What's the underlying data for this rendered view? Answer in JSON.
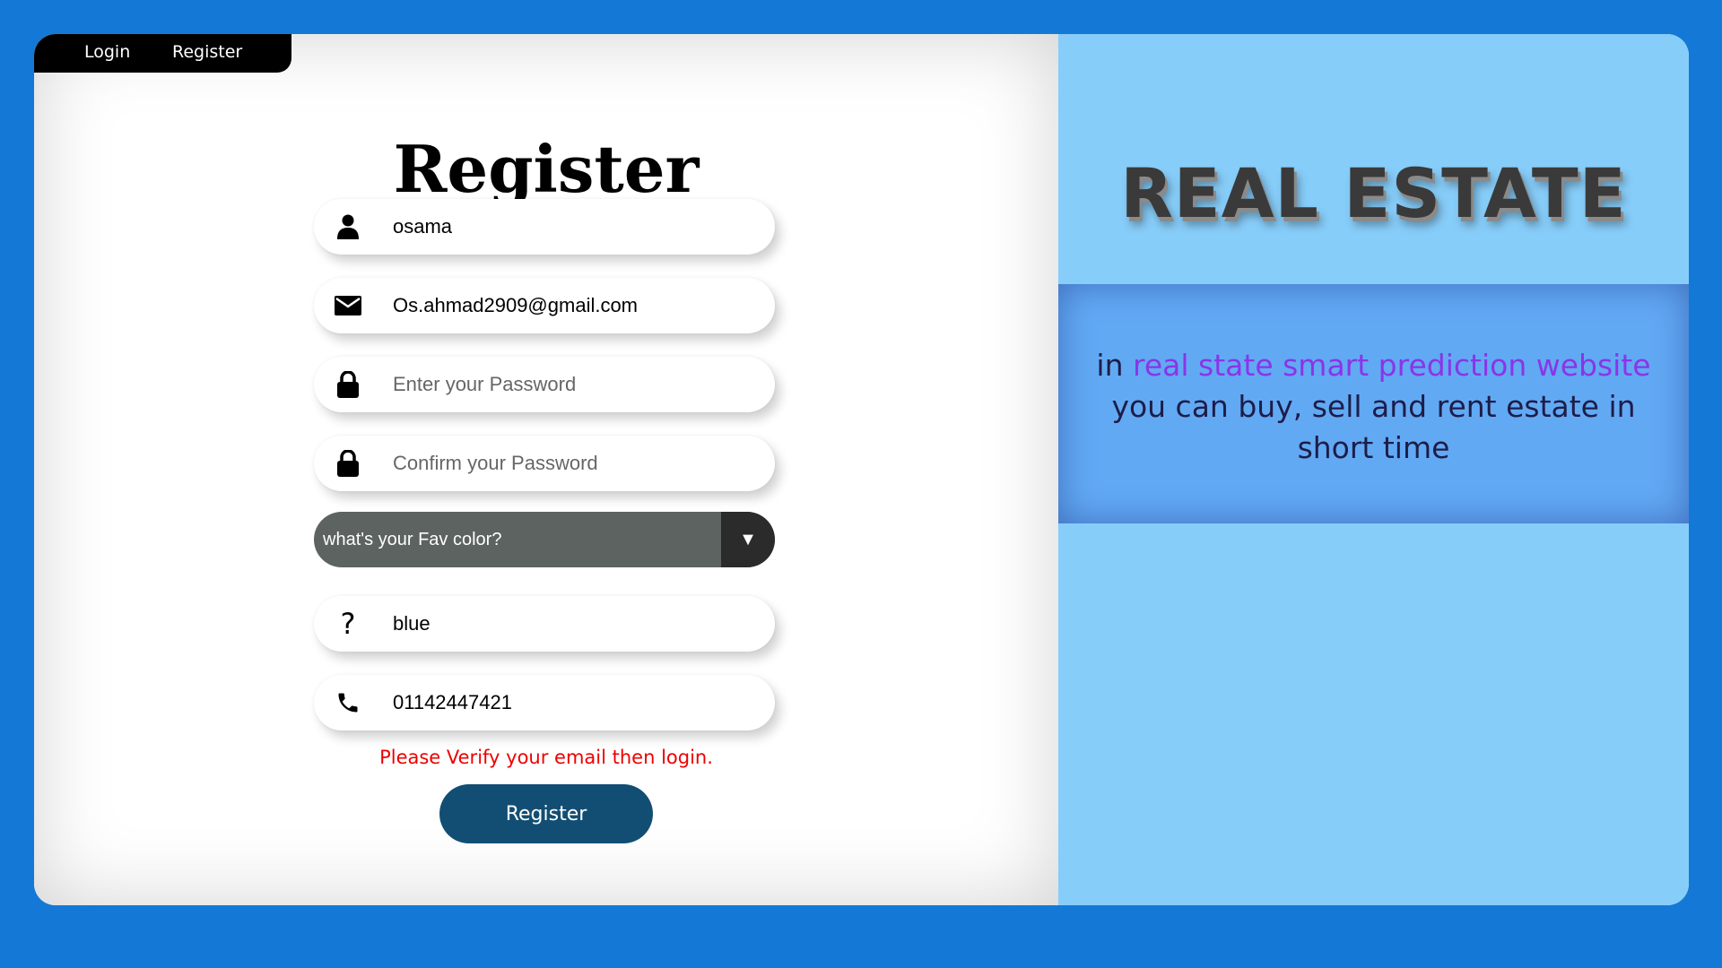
{
  "nav": {
    "login_label": "Login",
    "register_label": "Register"
  },
  "form": {
    "title": "Register",
    "fields": {
      "username": {
        "value": "osama",
        "icon": "user-icon"
      },
      "email": {
        "value": "Os.ahmad2909@gmail.com",
        "icon": "envelope-icon"
      },
      "password": {
        "value": "",
        "placeholder": "Enter your Password",
        "icon": "lock-icon"
      },
      "confirm_password": {
        "value": "",
        "placeholder": "Confirm your Password",
        "icon": "lock-icon"
      },
      "security_question": {
        "selected": "what's your Fav color?",
        "arrow": "▼"
      },
      "security_answer": {
        "value": "blue",
        "icon": "question-icon",
        "glyph": "?"
      },
      "phone": {
        "value": "01142447421",
        "icon": "phone-icon"
      }
    },
    "error_message": "Please Verify your email then login.",
    "submit_label": "Register"
  },
  "hero": {
    "brand": "REAL ESTATE",
    "description_prefix": "in ",
    "description_highlight": "real state smart prediction website",
    "description_suffix": " you can buy, sell and rent estate in short time"
  },
  "colors": {
    "background": "#1479d6",
    "right_panel": "#87cdf9",
    "description_band": "#62a9f4",
    "highlight": "#8a35e8",
    "error": "#e00000",
    "button": "#124e73",
    "select": "#5c6360"
  }
}
